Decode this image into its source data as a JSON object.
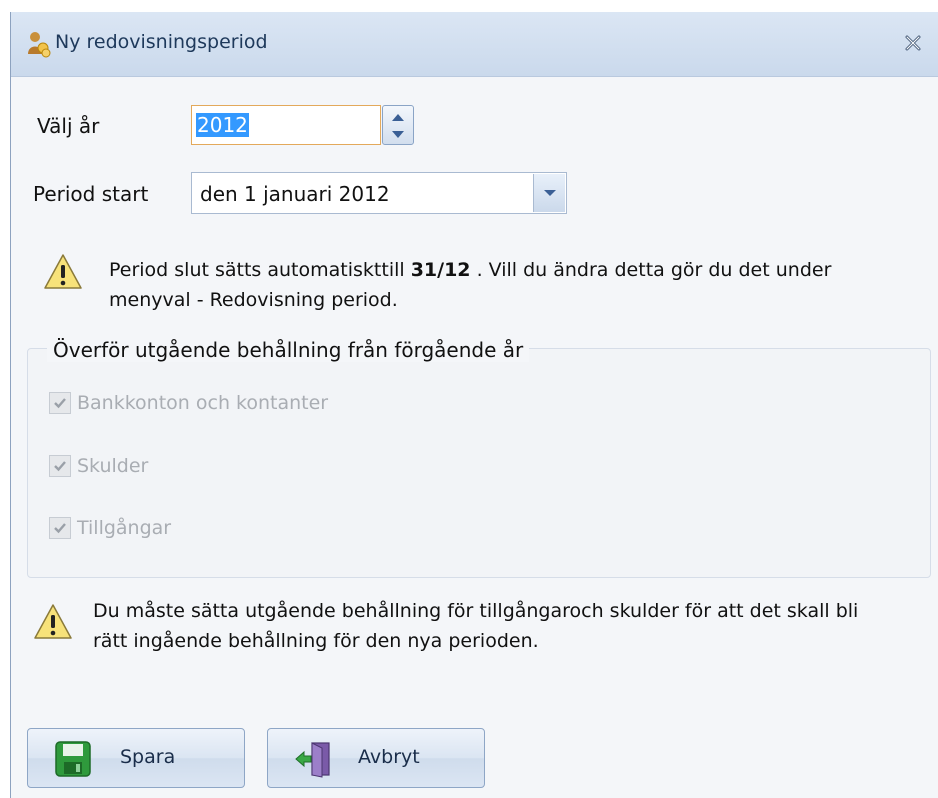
{
  "window": {
    "title": "Ny redovisningsperiod",
    "title_icon": "user-coins-icon",
    "close_icon": "close-icon"
  },
  "year": {
    "label": "Välj år",
    "value": "2012"
  },
  "period_start": {
    "label": "Period start",
    "value": "den 1 januari 2012"
  },
  "info_message": {
    "text_before": "Period slut sätts automatiskttill ",
    "bold": "31/12",
    "text_after": " . Vill du ändra detta gör du det under",
    "line2": "menyval - Redovisning period."
  },
  "carry_over": {
    "title": "Överför utgående behållning från förgående år",
    "items": [
      {
        "label": "Bankkonton och kontanter",
        "checked": true,
        "enabled": false
      },
      {
        "label": "Skulder",
        "checked": true,
        "enabled": false
      },
      {
        "label": "Tillgångar",
        "checked": true,
        "enabled": false
      }
    ]
  },
  "warning_message": {
    "line1": "Du måste sätta utgående behållning för tillgångaroch skulder för att det skall bli",
    "line2": "rätt ingående behållning för den nya perioden."
  },
  "buttons": {
    "save": "Spara",
    "cancel": "Avbryt"
  },
  "colors": {
    "accent": "#3399ff",
    "titlebar": "#cad9ec",
    "focus_border": "#e3a95b"
  }
}
